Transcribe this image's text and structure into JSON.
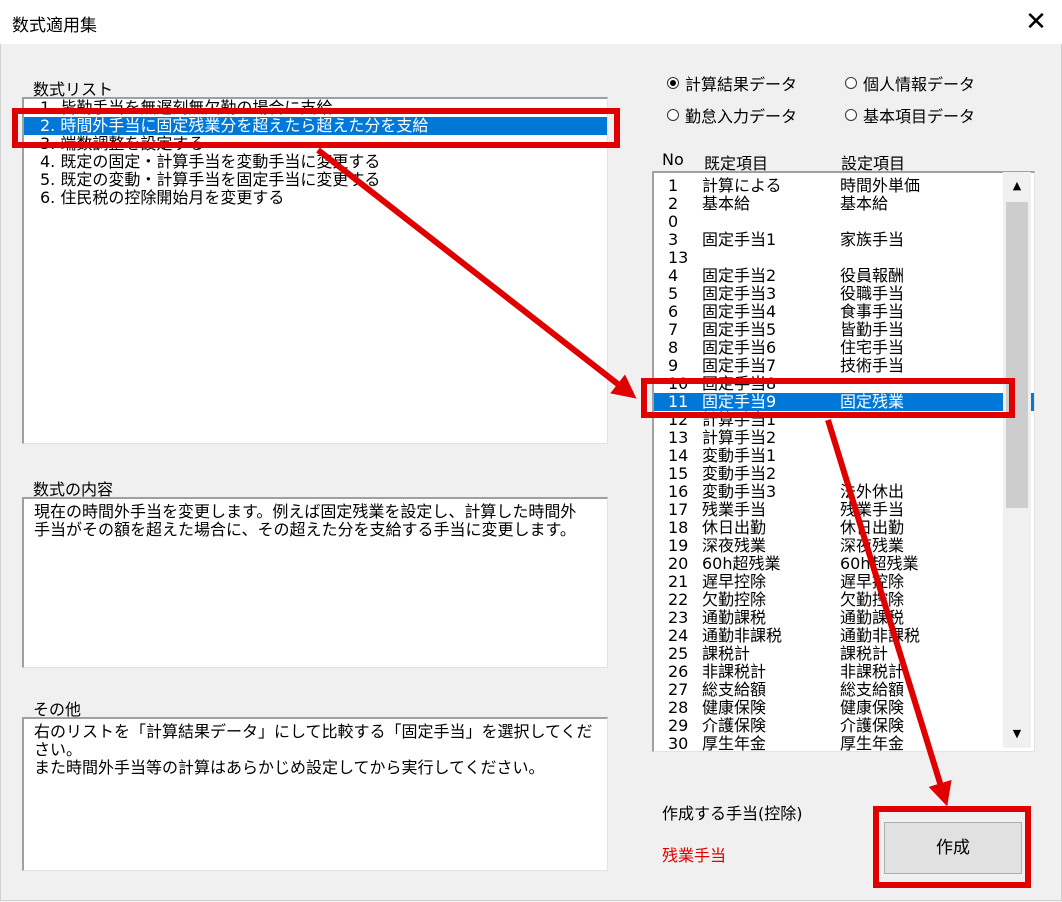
{
  "window": {
    "title": "数式適用集",
    "close_glyph": "✕"
  },
  "formula_list": {
    "label": "数式リスト",
    "items": [
      "1. 皆勤手当を無遅刻無欠勤の場合に支給",
      "2. 時間外手当に固定残業分を超えたら超えた分を支給",
      "3. 端数調整を設定する",
      "4. 既定の固定・計算手当を変動手当に変更する",
      "5. 既定の変動・計算手当を固定手当に変更する",
      "6. 住民税の控除開始月を変更する"
    ],
    "selected_index": 1
  },
  "content": {
    "label": "数式の内容",
    "lines": [
      "現在の時間外手当を変更します。例えば固定残業を設定し、計算した時間外",
      "手当がその額を超えた場合に、その超えた分を支給する手当に変更します。"
    ]
  },
  "other": {
    "label": "その他",
    "lines": [
      "右のリストを「計算結果データ」にして比較する「固定手当」を選択してください。",
      "また時間外手当等の計算はあらかじめ設定してから実行してください。"
    ]
  },
  "radios": [
    {
      "label": "計算結果データ",
      "checked": true
    },
    {
      "label": "個人情報データ",
      "checked": false
    },
    {
      "label": "勤怠入力データ",
      "checked": false
    },
    {
      "label": "基本項目データ",
      "checked": false
    }
  ],
  "list_headers": {
    "no": "No",
    "default": "既定項目",
    "setting": "設定項目"
  },
  "list_rows": [
    {
      "no": "1",
      "a": "計算による",
      "b": "時間外単価"
    },
    {
      "no": "2",
      "a": "基本給",
      "b": "基本給"
    },
    {
      "no": "0",
      "a": "",
      "b": ""
    },
    {
      "no": "3",
      "a": "固定手当1",
      "b": "家族手当"
    },
    {
      "no": "13",
      "a": "",
      "b": ""
    },
    {
      "no": "4",
      "a": "固定手当2",
      "b": "役員報酬"
    },
    {
      "no": "5",
      "a": "固定手当3",
      "b": "役職手当"
    },
    {
      "no": "6",
      "a": "固定手当4",
      "b": "食事手当"
    },
    {
      "no": "7",
      "a": "固定手当5",
      "b": "皆勤手当"
    },
    {
      "no": "8",
      "a": "固定手当6",
      "b": "住宅手当"
    },
    {
      "no": "9",
      "a": "固定手当7",
      "b": "技術手当"
    },
    {
      "no": "10",
      "a": "固定手当8",
      "b": ""
    },
    {
      "no": "11",
      "a": "固定手当9",
      "b": "固定残業"
    },
    {
      "no": "12",
      "a": "計算手当1",
      "b": ""
    },
    {
      "no": "13",
      "a": "計算手当2",
      "b": ""
    },
    {
      "no": "14",
      "a": "変動手当1",
      "b": ""
    },
    {
      "no": "15",
      "a": "変動手当2",
      "b": ""
    },
    {
      "no": "16",
      "a": "変動手当3",
      "b": "法外休出"
    },
    {
      "no": "17",
      "a": "残業手当",
      "b": "残業手当"
    },
    {
      "no": "18",
      "a": "休日出勤",
      "b": "休日出勤"
    },
    {
      "no": "19",
      "a": "深夜残業",
      "b": "深夜残業"
    },
    {
      "no": "20",
      "a": "60h超残業",
      "b": "60h超残業"
    },
    {
      "no": "21",
      "a": "遅早控除",
      "b": "遅早控除"
    },
    {
      "no": "22",
      "a": "欠勤控除",
      "b": "欠勤控除"
    },
    {
      "no": "23",
      "a": "通勤課税",
      "b": "通勤課税"
    },
    {
      "no": "24",
      "a": "通勤非課税",
      "b": "通勤非課税"
    },
    {
      "no": "25",
      "a": "課税計",
      "b": "課税計"
    },
    {
      "no": "26",
      "a": "非課税計",
      "b": "非課税計"
    },
    {
      "no": "27",
      "a": "総支給額",
      "b": "総支給額"
    },
    {
      "no": "28",
      "a": "健康保険",
      "b": "健康保険"
    },
    {
      "no": "29",
      "a": "介護保険",
      "b": "介護保険"
    },
    {
      "no": "30",
      "a": "厚生年金",
      "b": "厚生年金"
    }
  ],
  "selected_row_index": 12,
  "scroll_up_glyph": "▲",
  "scroll_down_glyph": "▼",
  "create": {
    "label": "作成する手当(控除)",
    "value": "残業手当",
    "value_color": "#e00000",
    "button": "作成"
  },
  "annotation_color": "#e00000"
}
